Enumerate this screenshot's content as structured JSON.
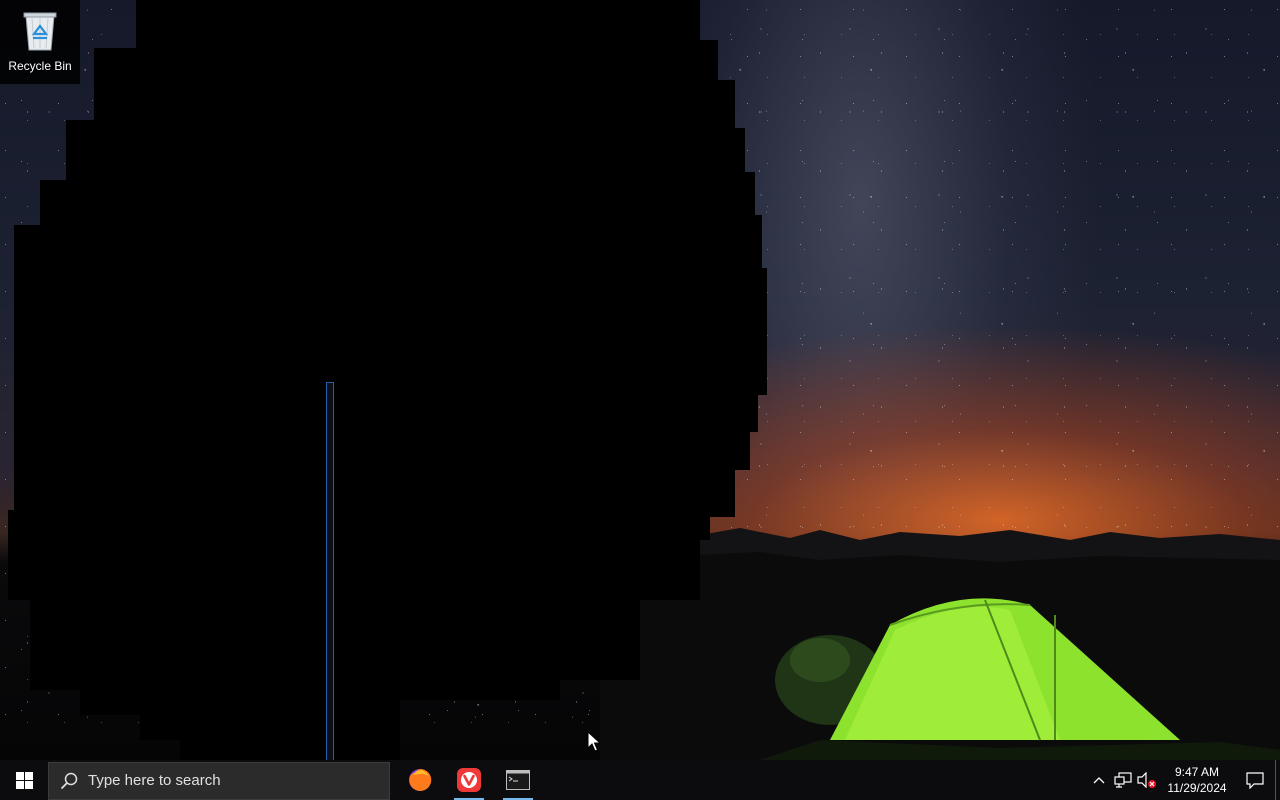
{
  "desktop": {
    "icons": [
      {
        "label": "Recycle Bin",
        "icon": "recycle-bin-icon"
      }
    ]
  },
  "taskbar": {
    "start_icon": "windows-logo-icon",
    "search": {
      "placeholder": "Type here to search",
      "icon": "search-icon"
    },
    "apps": [
      {
        "icon": "firefox-icon",
        "running": false
      },
      {
        "icon": "vivaldi-icon",
        "running": true
      },
      {
        "icon": "terminal-icon",
        "running": true
      }
    ],
    "tray": {
      "icons": [
        "chevron-up-icon",
        "network-icon",
        "volume-muted-icon"
      ],
      "time": "9:47 AM",
      "date": "11/29/2024",
      "notification_icon": "action-center-icon"
    }
  },
  "colors": {
    "taskbar_bg": "#0c0c0f",
    "running_indicator": "#76b9ed",
    "tent_green": "#7ad22a",
    "horizon_orange": "#e86a28"
  }
}
